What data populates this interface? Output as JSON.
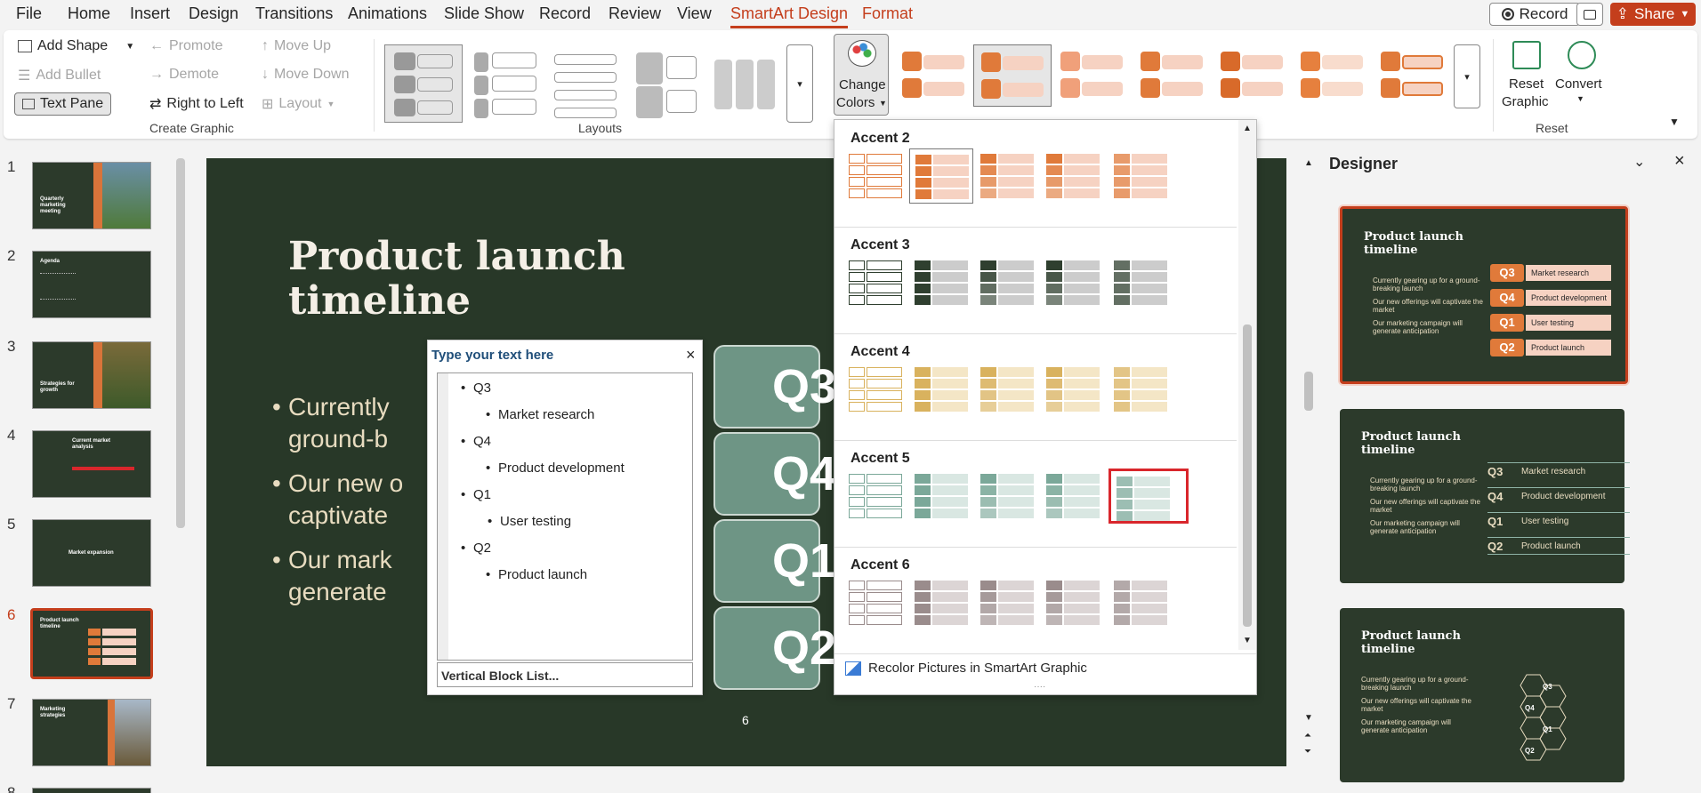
{
  "menubar": {
    "items": [
      "File",
      "Home",
      "Insert",
      "Design",
      "Transitions",
      "Animations",
      "Slide Show",
      "Record",
      "Review",
      "View",
      "SmartArt Design",
      "Format"
    ],
    "record_button": "Record",
    "share_button": "Share"
  },
  "ribbon": {
    "add_shape": "Add Shape",
    "add_bullet": "Add Bullet",
    "text_pane": "Text Pane",
    "promote": "Promote",
    "demote": "Demote",
    "right_to_left": "Right to Left",
    "move_up": "Move Up",
    "move_down": "Move Down",
    "layout": "Layout",
    "group_create": "Create Graphic",
    "group_layouts": "Layouts",
    "change_colors_line1": "Change",
    "change_colors_line2": "Colors",
    "reset_graphic_line1": "Reset",
    "reset_graphic_line2": "Graphic",
    "convert": "Convert",
    "group_reset": "Reset"
  },
  "slides": {
    "numbers": [
      "1",
      "2",
      "3",
      "4",
      "5",
      "6",
      "7",
      "8"
    ],
    "titles": [
      "Quarterly marketing meeting",
      "Agenda",
      "",
      "Current market analysis",
      "Market expansion",
      "Product launch timeline",
      "Marketing strategies",
      ""
    ],
    "current": "6"
  },
  "slide": {
    "title_line1": "Product launch",
    "title_line2": "timeline",
    "bullets": [
      "Currently",
      "ground-b",
      "Our new o",
      "captivate",
      "Our mark",
      "generate"
    ],
    "quarters": [
      "Q3",
      "Q4",
      "Q1",
      "Q2"
    ],
    "number": "6"
  },
  "text_pane": {
    "title": "Type your text here",
    "items": [
      {
        "level": 1,
        "text": "Q3"
      },
      {
        "level": 2,
        "text": "Market research"
      },
      {
        "level": 1,
        "text": "Q4"
      },
      {
        "level": 2,
        "text": "Product development"
      },
      {
        "level": 1,
        "text": "Q1"
      },
      {
        "level": 2,
        "text": "User testing"
      },
      {
        "level": 1,
        "text": "Q2"
      },
      {
        "level": 2,
        "text": "Product launch"
      }
    ],
    "footer": "Vertical Block List..."
  },
  "colors_dropdown": {
    "sections": [
      {
        "name": "Accent 2",
        "dark": "#e07a3a",
        "light": "#f6d2c2",
        "outline": "#e07a3a"
      },
      {
        "name": "Accent 3",
        "dark": "#2f3f2f",
        "light": "#cccccc",
        "outline": "#2f3f2f"
      },
      {
        "name": "Accent 4",
        "dark": "#d9b25e",
        "light": "#f4e6c6",
        "outline": "#d9b25e"
      },
      {
        "name": "Accent 5",
        "dark": "#7ba899",
        "light": "#d9e7e2",
        "outline": "#7ba899"
      },
      {
        "name": "Accent 6",
        "dark": "#9a8c8c",
        "light": "#dcd5d5",
        "outline": "#9a8c8c"
      }
    ],
    "recolor": "Recolor Pictures in SmartArt Graphic"
  },
  "designer": {
    "title": "Designer",
    "card_title_line1": "Product launch",
    "card_title_line2": "timeline",
    "card_bullets": [
      "Currently gearing up for a ground-breaking launch",
      "Our new offerings will captivate the market",
      "Our marketing campaign will generate anticipation"
    ],
    "card_rows": [
      {
        "q": "Q3",
        "t": "Market research"
      },
      {
        "q": "Q4",
        "t": "Product development"
      },
      {
        "q": "Q1",
        "t": "User testing"
      },
      {
        "q": "Q2",
        "t": "Product launch"
      }
    ]
  },
  "colors": {
    "accent": "#c43e1c",
    "slide_bg": "#283828",
    "highlight": "#d9262c"
  }
}
